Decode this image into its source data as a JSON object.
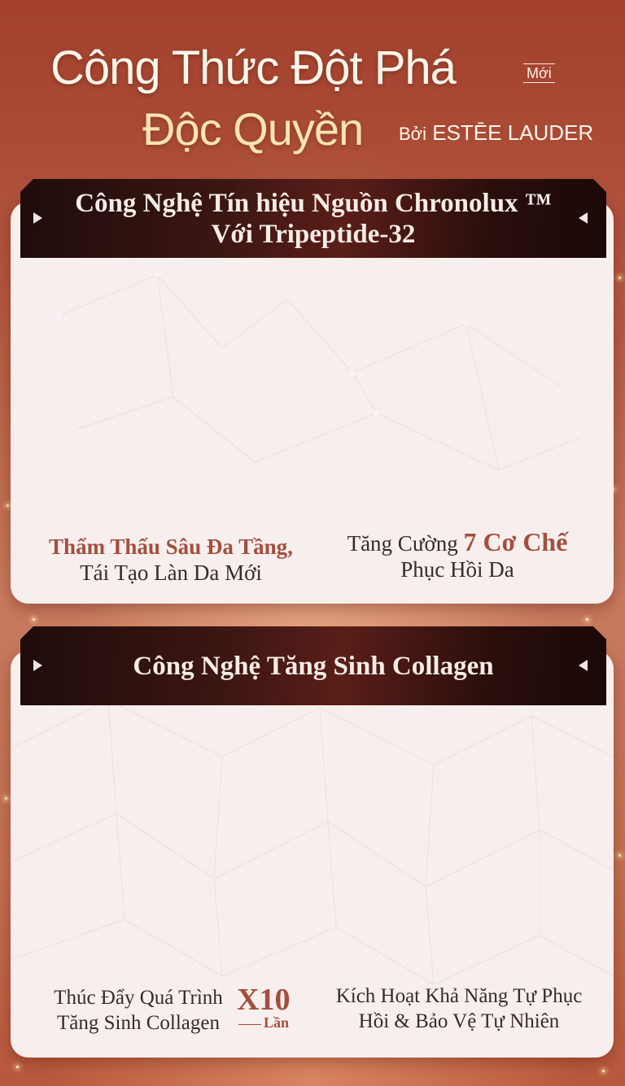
{
  "header": {
    "title_line1": "Công Thức Đột Phá",
    "badge_new": "Mới",
    "title_line2": "Độc Quyền",
    "by_label": "Bởi",
    "brand": "ESTĒE LAUDER"
  },
  "section1": {
    "banner_line1": "Công Nghệ Tín hiệu Nguồn Chronolux ™",
    "banner_line2": "Với Tripeptide-32",
    "feature_left_accent": "Thẩm Thấu Sâu Đa Tầng,",
    "feature_left_text": "Tái Tạo Làn Da Mới",
    "feature_right_pre": "Tăng Cường",
    "feature_right_accent": "7 Cơ Chế",
    "feature_right_text": "Phục Hồi Da"
  },
  "section2": {
    "banner_title": "Công Nghệ Tăng Sinh Collagen",
    "feature_left_line1": "Thúc Đẩy Quá Trình",
    "feature_left_line2": "Tăng Sinh Collagen",
    "multiplier": "X10",
    "multiplier_unit": "Lần",
    "feature_right_line1": "Kích Hoạt Khả Năng Tự Phục",
    "feature_right_line2": "Hồi & Bảo Vệ Tự Nhiên"
  },
  "colors": {
    "background": "#b55a43",
    "accent": "#a54e3d",
    "banner": "#3c1613",
    "card": "#f7efee"
  }
}
